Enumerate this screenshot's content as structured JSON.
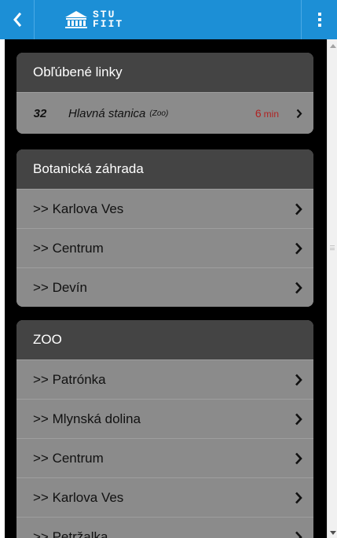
{
  "header": {
    "logo_text_line1": "STU",
    "logo_text_line2": "FIIT",
    "back_icon": "chevron-left-icon",
    "menu_icon": "more-vertical-icon"
  },
  "favorites": {
    "title": "Obľúbené linky",
    "items": [
      {
        "line": "32",
        "stop": "Hlavná stanica",
        "direction": "(Zoo)",
        "time": "6",
        "time_unit": "min"
      }
    ]
  },
  "sections": [
    {
      "title": "Botanická záhrada",
      "items": [
        ">> Karlova Ves",
        ">> Centrum",
        ">> Devín"
      ]
    },
    {
      "title": "ZOO",
      "items": [
        ">> Patrónka",
        ">> Mlynská dolina",
        ">> Centrum",
        ">> Karlova Ves",
        ">> Petržalka"
      ]
    }
  ],
  "colors": {
    "appbar": "#1c8fd6",
    "card_header": "#444444",
    "row": "#8b8b8b",
    "time": "#b02323"
  }
}
